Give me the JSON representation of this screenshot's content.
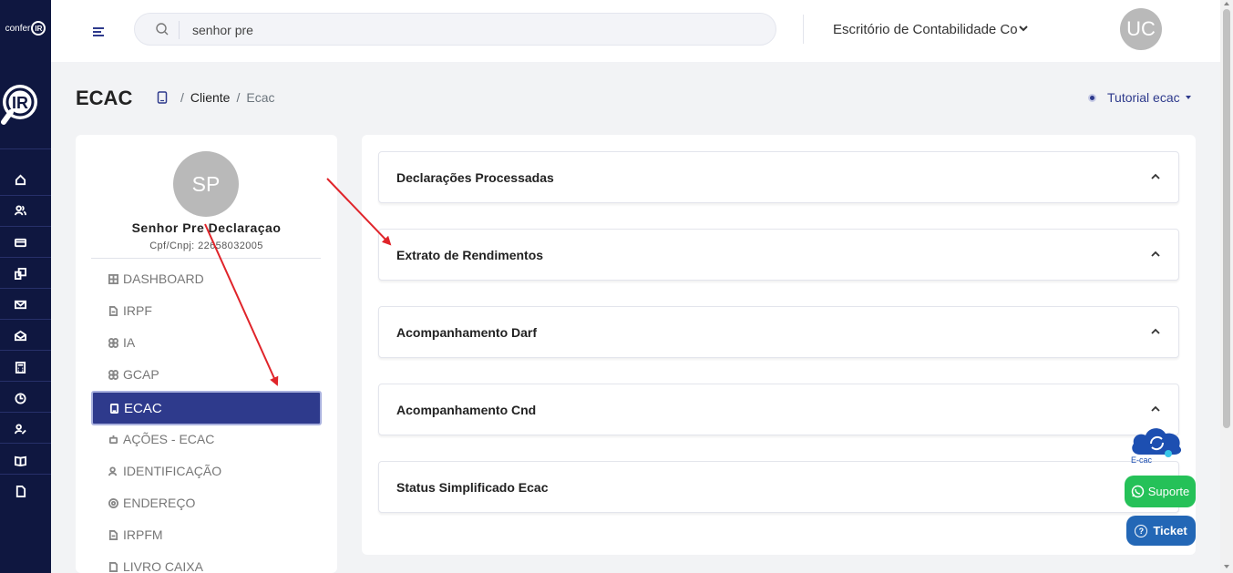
{
  "rail": {
    "logo_top_text": "confer",
    "logo_top_mark": "IR",
    "logo_main_mark": "IR",
    "icons": [
      "home-icon",
      "users-icon",
      "card-icon",
      "devices-icon",
      "mail-icon",
      "mail-open-icon",
      "calculator-icon",
      "clock-icon",
      "user-edit-icon",
      "book-icon",
      "document-icon"
    ]
  },
  "header": {
    "search_value": "senhor pre",
    "company": "Escritório de Contabilidade Co",
    "user_initials": "UC"
  },
  "page": {
    "title": "ECAC",
    "breadcrumb": {
      "cliente": "Cliente",
      "current": "Ecac",
      "sep": "/"
    },
    "tutorial": "Tutorial ecac"
  },
  "profile": {
    "initials": "SP",
    "name": "Senhor Pre Declaraçao",
    "cpf": "Cpf/Cnpj: 22658032005"
  },
  "menu": {
    "dashboard": "DASHBOARD",
    "irpf": "IRPF",
    "ia": "IA",
    "gcap": "GCAP",
    "ecac": "ECAC",
    "acoes": "AÇÕES - ECAC",
    "identificacao": "IDENTIFICAÇÃO",
    "endereco": "ENDEREÇO",
    "irpfm": "IRPFM",
    "livro": "LIVRO CAIXA"
  },
  "sections": [
    "Declarações Processadas",
    "Extrato de Rendimentos",
    "Acompanhamento Darf",
    "Acompanhamento Cnd",
    "Status Simplificado Ecac"
  ],
  "widgets": {
    "ecac_label": "E-cac",
    "suporte": "Suporte",
    "ticket": "Ticket"
  },
  "colors": {
    "rail": "#0f1740",
    "primary": "#2e3a8c",
    "annotation_arrow": "#e0242a",
    "suporte": "#25c158",
    "ticket": "#2367b6"
  }
}
